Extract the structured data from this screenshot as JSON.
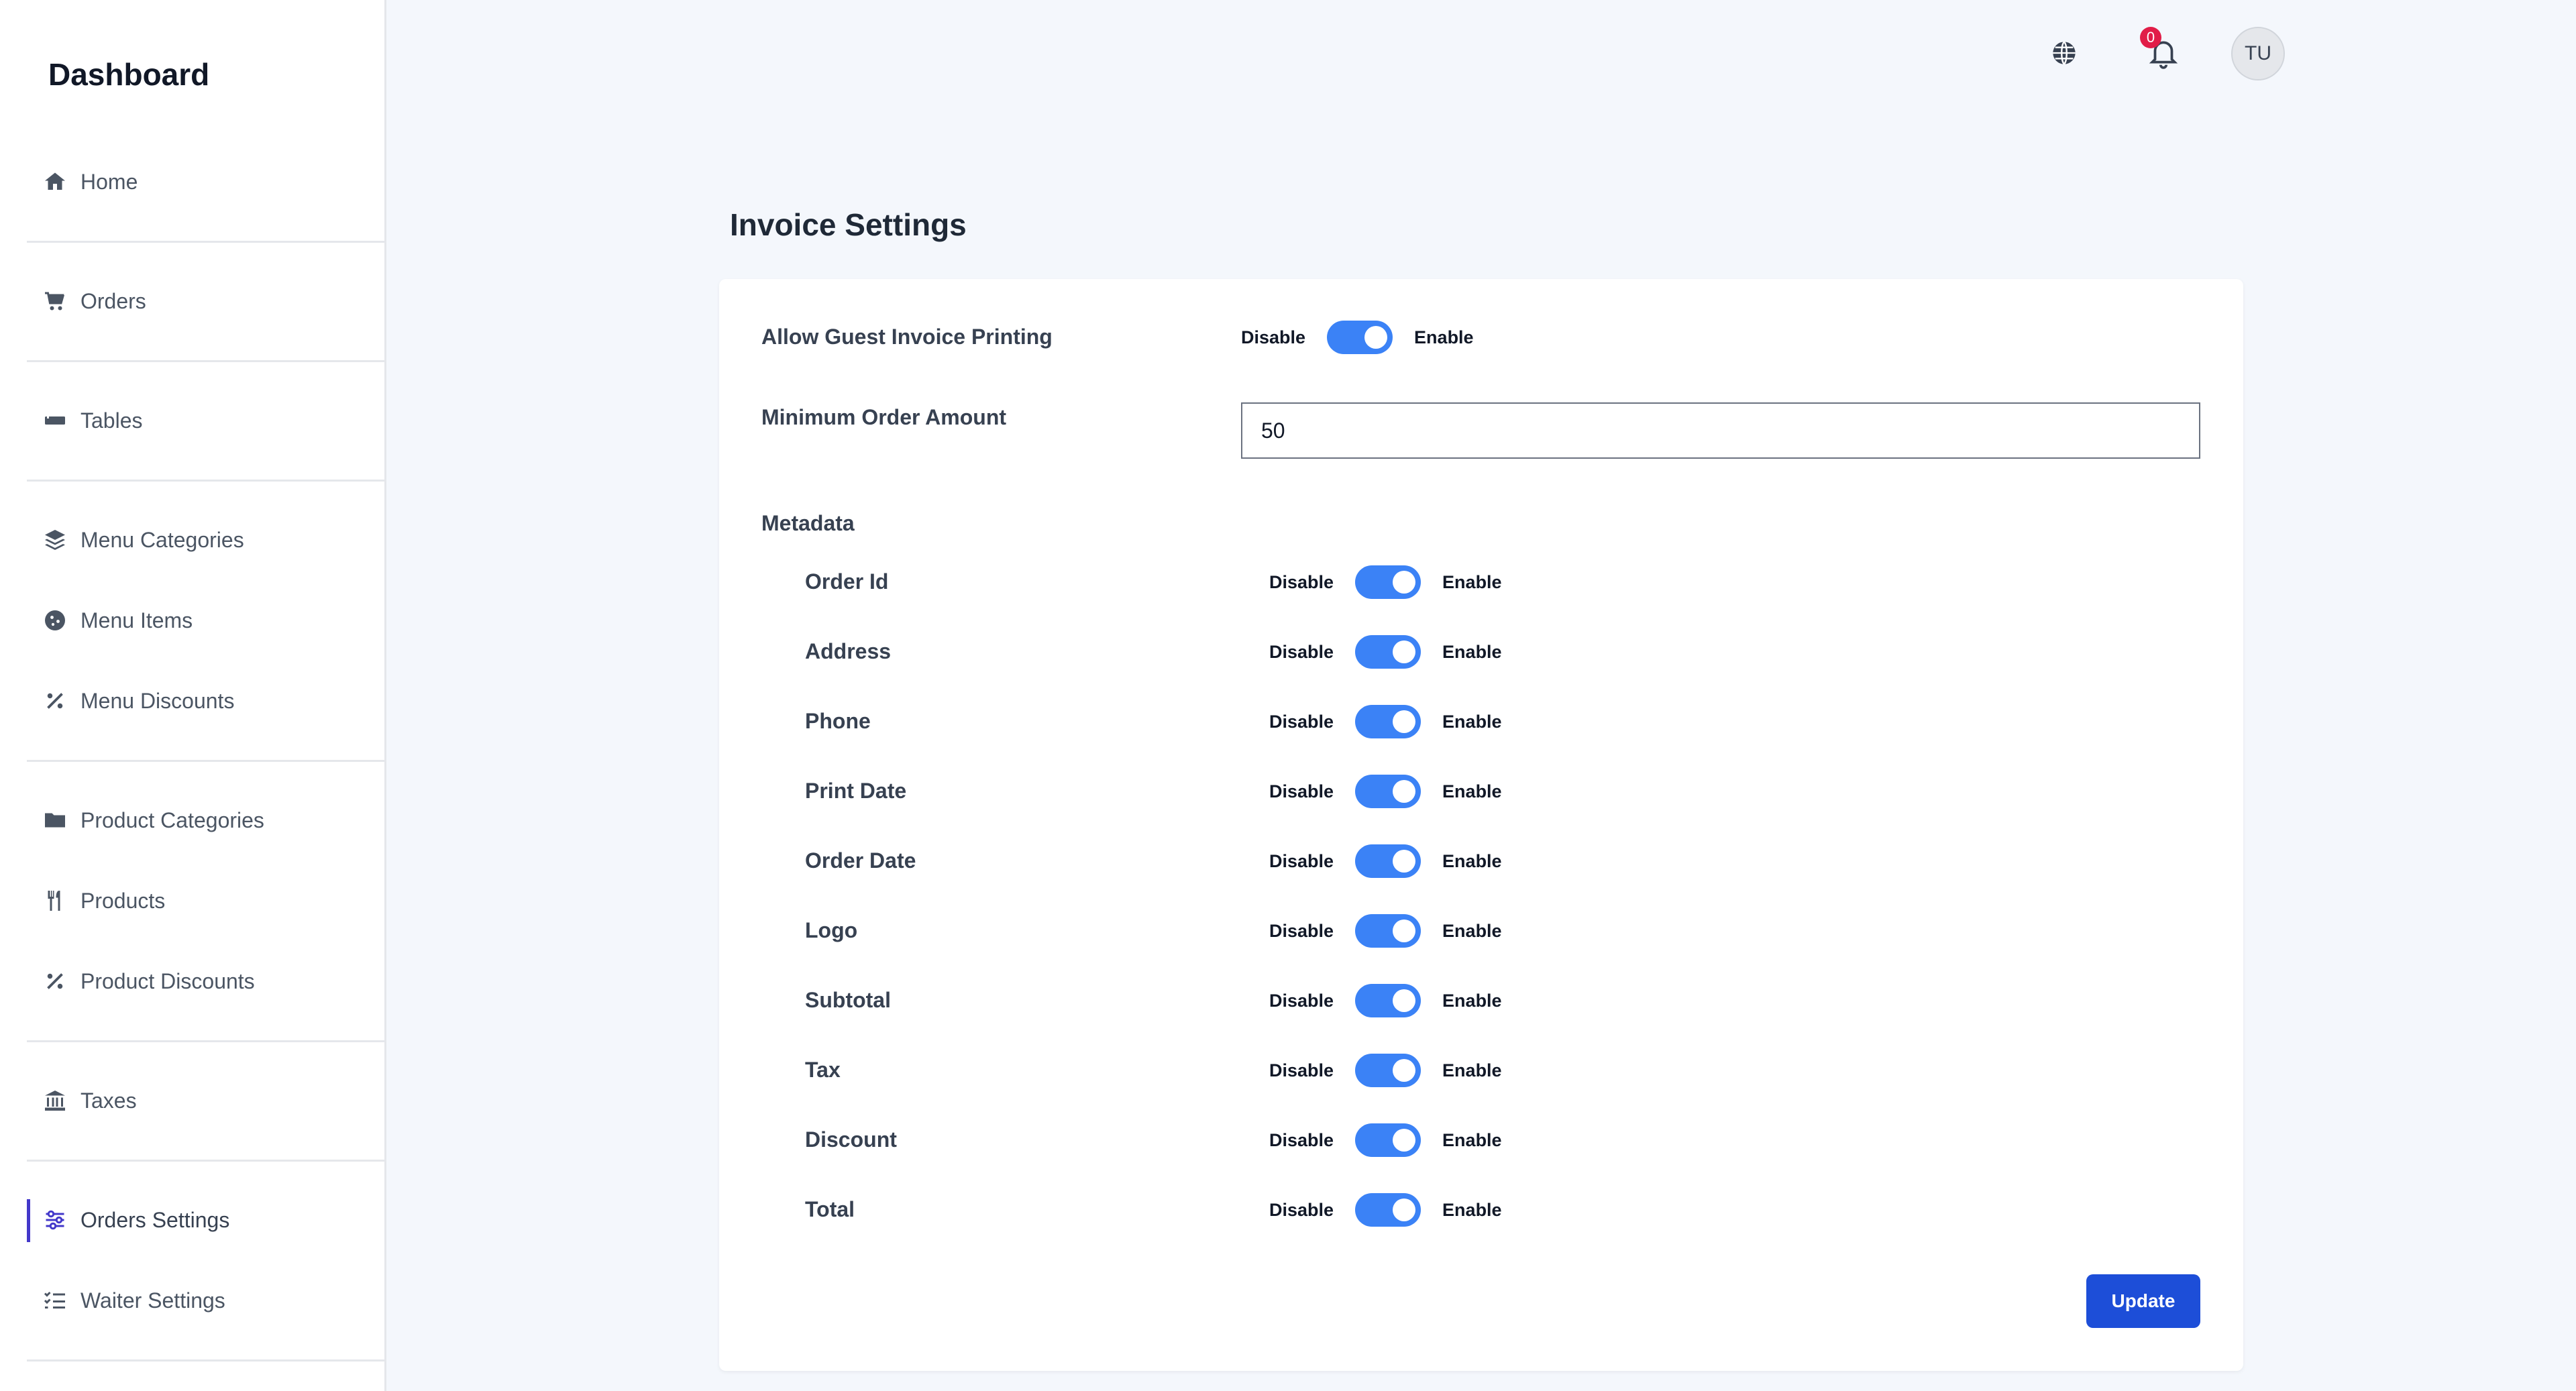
{
  "sidebar": {
    "title": "Dashboard",
    "items": [
      {
        "label": "Home",
        "icon": "home-icon"
      },
      {
        "label": "Orders",
        "icon": "cart-icon"
      },
      {
        "label": "Tables",
        "icon": "table-icon"
      },
      {
        "label": "Menu Categories",
        "icon": "layers-icon"
      },
      {
        "label": "Menu Items",
        "icon": "cookie-icon"
      },
      {
        "label": "Menu Discounts",
        "icon": "percent-icon"
      },
      {
        "label": "Product Categories",
        "icon": "folder-icon"
      },
      {
        "label": "Products",
        "icon": "utensils-icon"
      },
      {
        "label": "Product Discounts",
        "icon": "percent-icon"
      },
      {
        "label": "Taxes",
        "icon": "bank-icon"
      },
      {
        "label": "Orders Settings",
        "icon": "sliders-icon",
        "active": true
      },
      {
        "label": "Waiter Settings",
        "icon": "checklist-icon"
      }
    ]
  },
  "header": {
    "notification_count": "0",
    "avatar_initials": "TU"
  },
  "main": {
    "title": "Invoice Settings",
    "guest_printing": {
      "label": "Allow Guest Invoice Printing",
      "off": "Disable",
      "on": "Enable",
      "enabled": true
    },
    "min_order": {
      "label": "Minimum Order Amount",
      "value": "50"
    },
    "metadata": {
      "label": "Metadata",
      "off": "Disable",
      "on": "Enable",
      "items": [
        {
          "label": "Order Id",
          "enabled": true
        },
        {
          "label": "Address",
          "enabled": true
        },
        {
          "label": "Phone",
          "enabled": true
        },
        {
          "label": "Print Date",
          "enabled": true
        },
        {
          "label": "Order Date",
          "enabled": true
        },
        {
          "label": "Logo",
          "enabled": true
        },
        {
          "label": "Subtotal",
          "enabled": true
        },
        {
          "label": "Tax",
          "enabled": true
        },
        {
          "label": "Discount",
          "enabled": true
        },
        {
          "label": "Total",
          "enabled": true
        }
      ]
    },
    "update_label": "Update"
  },
  "colors": {
    "accent": "#3b82f6",
    "button": "#1d4ed8",
    "active_nav": "#4338ca",
    "badge": "#e11d48"
  }
}
